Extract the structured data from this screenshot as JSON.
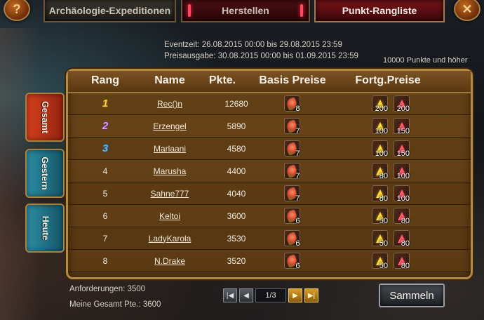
{
  "tabs": {
    "help": "?",
    "close": "✕",
    "archaeologie": "Archäologie-Expeditionen",
    "herstellen": "Herstellen",
    "rangliste": "Punkt-Rangliste"
  },
  "info": {
    "eventzeit": "Eventzeit: 26.08.2015 00:00 bis 29.08.2015 23:59",
    "preisausgabe": "Preisausgabe: 30.08.2015 00:00 bis 01.09.2015 23:59",
    "punkte_hinweis": "10000 Punkte und höher"
  },
  "side_tabs": {
    "gesamt": "Gesamt",
    "gestern": "Gestern",
    "heute": "Heute"
  },
  "table": {
    "headers": {
      "rang": "Rang",
      "name": "Name",
      "pkte": "Pkte.",
      "basis": "Basis Preise",
      "fortg": "Fortg.Preise"
    },
    "rows": [
      {
        "rank": "1",
        "rank_style": "gold",
        "name": "Rec()n",
        "points": "12680",
        "basis": "8",
        "fortg_yellow": "200",
        "fortg_red": "200"
      },
      {
        "rank": "2",
        "rank_style": "purple",
        "name": "Erzengel",
        "points": "5890",
        "basis": "7",
        "fortg_yellow": "100",
        "fortg_red": "150"
      },
      {
        "rank": "3",
        "rank_style": "blue",
        "name": "Marlaani",
        "points": "4580",
        "basis": "7",
        "fortg_yellow": "100",
        "fortg_red": "150"
      },
      {
        "rank": "4",
        "rank_style": "plain",
        "name": "Marusha",
        "points": "4400",
        "basis": "7",
        "fortg_yellow": "80",
        "fortg_red": "100"
      },
      {
        "rank": "5",
        "rank_style": "plain",
        "name": "Sahne777",
        "points": "4040",
        "basis": "7",
        "fortg_yellow": "80",
        "fortg_red": "100"
      },
      {
        "rank": "6",
        "rank_style": "plain",
        "name": "Keltoi",
        "points": "3600",
        "basis": "6",
        "fortg_yellow": "50",
        "fortg_red": "80"
      },
      {
        "rank": "7",
        "rank_style": "plain",
        "name": "LadyKarola",
        "points": "3530",
        "basis": "6",
        "fortg_yellow": "50",
        "fortg_red": "80"
      },
      {
        "rank": "8",
        "rank_style": "plain",
        "name": "N.Drake",
        "points": "3520",
        "basis": "6",
        "fortg_yellow": "50",
        "fortg_red": "80"
      }
    ]
  },
  "footer": {
    "anforderungen": "Anforderungen: 3500",
    "meine_gesamt": "Meine Gesamt Pte.: 3600",
    "page": "1/3",
    "first": "|◀",
    "prev": "◀",
    "next": "▶",
    "last": "▶|",
    "sammeln": "Sammeln"
  }
}
